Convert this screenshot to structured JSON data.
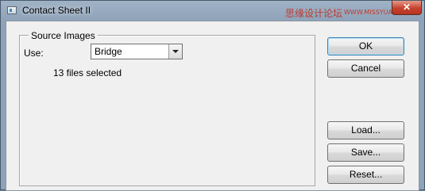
{
  "window": {
    "title": "Contact Sheet II",
    "close_label": "✕",
    "watermark_text": "思缘设计论坛",
    "watermark_site": "WWW.MISSYUAN.COM"
  },
  "source_images": {
    "legend": "Source Images",
    "use_label": "Use:",
    "use_value": "Bridge",
    "files_selected": "13 files selected"
  },
  "buttons": {
    "ok": "OK",
    "cancel": "Cancel",
    "load": "Load...",
    "save": "Save...",
    "reset": "Reset..."
  },
  "colors": {
    "accent": "#3c7fb1",
    "close_button": "#c4432d"
  }
}
